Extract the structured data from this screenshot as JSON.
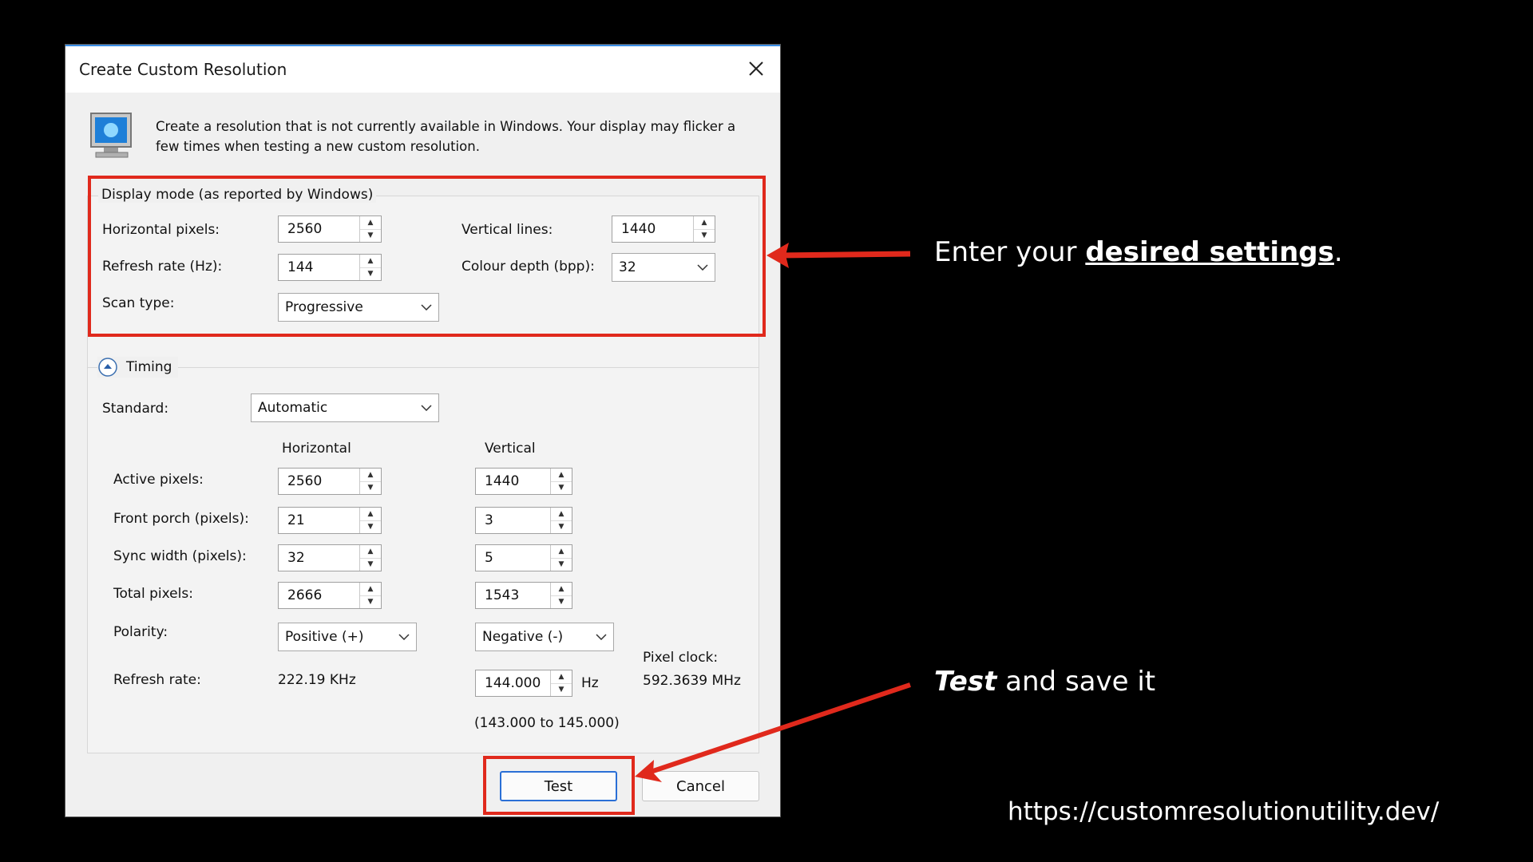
{
  "dialog": {
    "title": "Create Custom Resolution",
    "info_text": "Create a resolution that is not currently available in Windows. Your display may flicker a few times when testing a new custom resolution."
  },
  "display_mode": {
    "group_label": "Display mode (as reported by Windows)",
    "horizontal_pixels_label": "Horizontal pixels:",
    "horizontal_pixels_value": "2560",
    "vertical_lines_label": "Vertical lines:",
    "vertical_lines_value": "1440",
    "refresh_rate_label": "Refresh rate (Hz):",
    "refresh_rate_value": "144",
    "colour_depth_label": "Colour depth (bpp):",
    "colour_depth_value": "32",
    "scan_type_label": "Scan type:",
    "scan_type_value": "Progressive"
  },
  "timing": {
    "group_label": "Timing",
    "standard_label": "Standard:",
    "standard_value": "Automatic",
    "col_horizontal": "Horizontal",
    "col_vertical": "Vertical",
    "rows": {
      "active": {
        "label": "Active pixels:",
        "h": "2560",
        "v": "1440"
      },
      "front_porch": {
        "label": "Front porch (pixels):",
        "h": "21",
        "v": "3"
      },
      "sync_width": {
        "label": "Sync width (pixels):",
        "h": "32",
        "v": "5"
      },
      "total": {
        "label": "Total pixels:",
        "h": "2666",
        "v": "1543"
      }
    },
    "polarity_label": "Polarity:",
    "polarity_h": "Positive (+)",
    "polarity_v": "Negative (-)",
    "refresh_rate_label": "Refresh rate:",
    "refresh_rate_h": "222.19 KHz",
    "refresh_rate_v": "144.000",
    "refresh_rate_unit": "Hz",
    "refresh_range": "(143.000 to 145.000)",
    "pixel_clock_label": "Pixel clock:",
    "pixel_clock_value": "592.3639 MHz"
  },
  "buttons": {
    "test": "Test",
    "cancel": "Cancel"
  },
  "annotations": {
    "settings_prefix": "Enter your ",
    "settings_bold": "desired settings",
    "settings_suffix": ".",
    "test_bold": "Test",
    "test_suffix": " and save it",
    "url": "https://customresolutionutility.dev/"
  },
  "colors": {
    "highlight": "#e0291c",
    "background": "#000000",
    "dialog": "#f0f0f0"
  }
}
